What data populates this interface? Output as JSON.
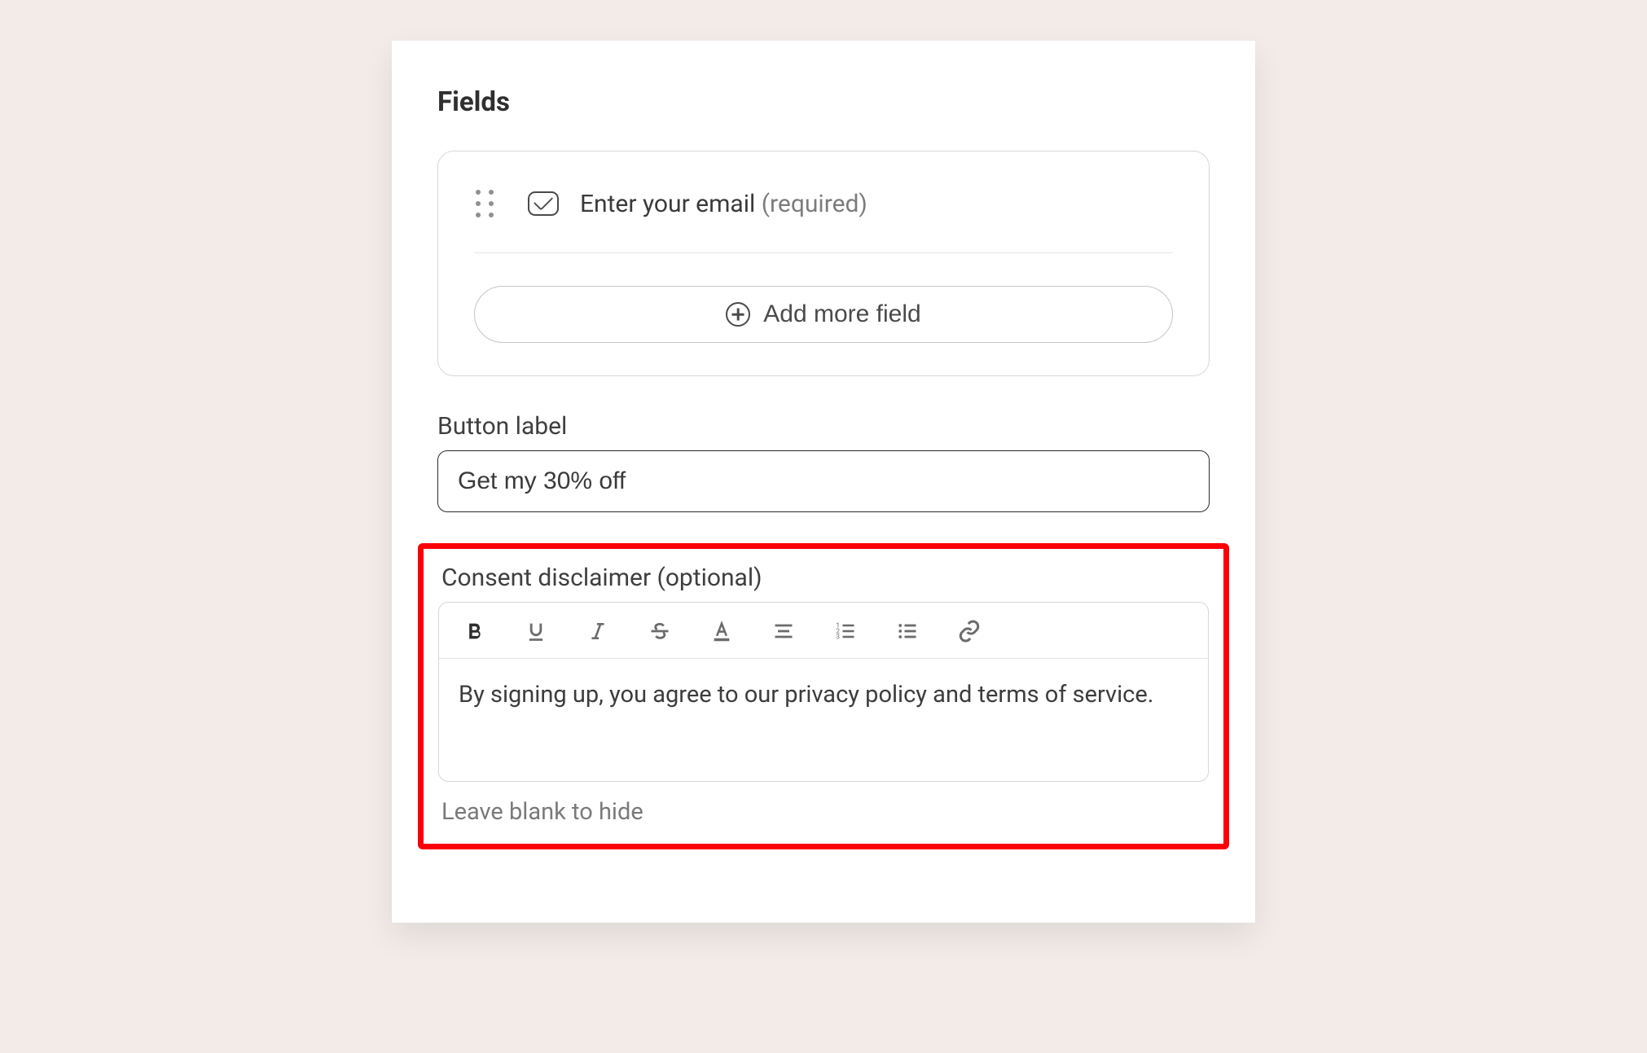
{
  "sections": {
    "fields_title": "Fields",
    "field_item": {
      "label": "Enter your email",
      "required_text": "(required)"
    },
    "add_button": "Add more field"
  },
  "button_label": {
    "label": "Button label",
    "value": "Get my 30% off"
  },
  "consent": {
    "label": "Consent disclaimer (optional)",
    "content": "By signing up, you agree to our privacy policy and terms of service.",
    "hint": "Leave blank to hide"
  }
}
